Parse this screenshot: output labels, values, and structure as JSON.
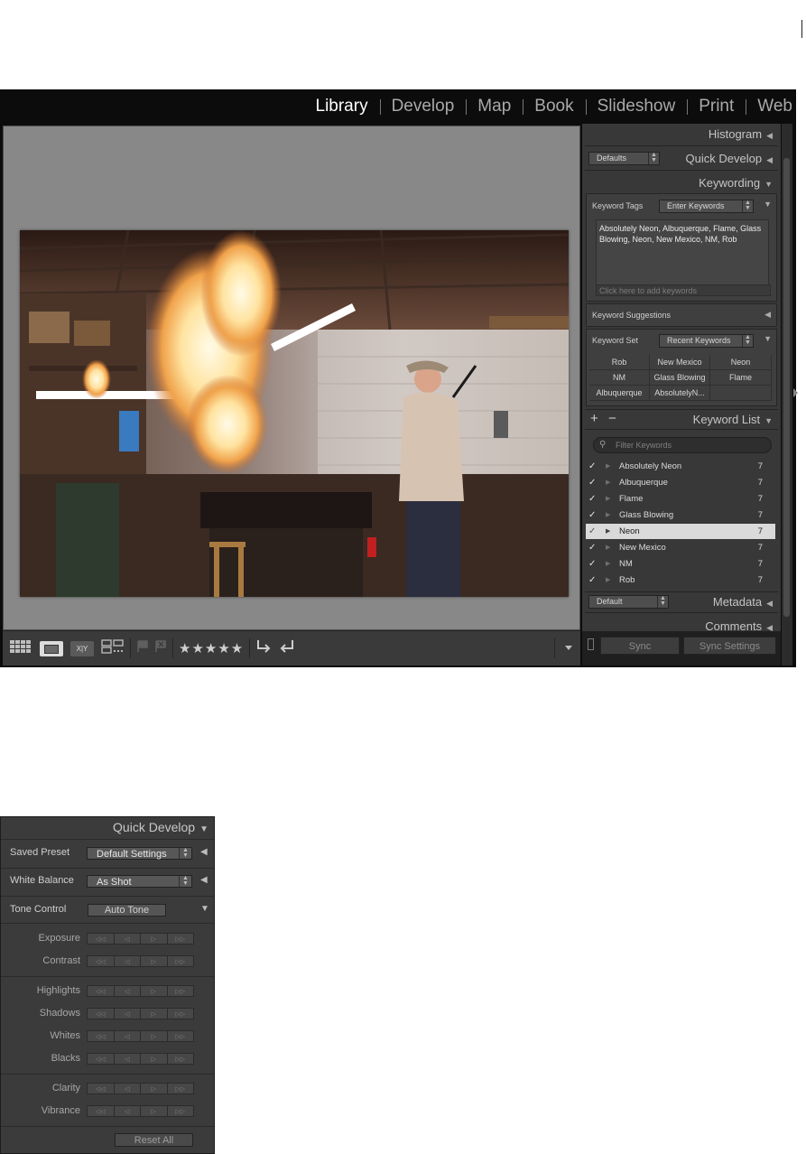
{
  "modules": [
    "Library",
    "Develop",
    "Map",
    "Book",
    "Slideshow",
    "Print",
    "Web"
  ],
  "active_module": "Library",
  "toolbar": {
    "view_icons": [
      "grid-view-icon",
      "loupe-view-icon",
      "compare-view-icon",
      "survey-view-icon"
    ],
    "compare_label": "X|Y",
    "stars": "★★★★★"
  },
  "right_panel": {
    "histogram": "Histogram",
    "quick_develop": {
      "title": "Quick Develop",
      "preset": "Defaults"
    },
    "keywording": {
      "title": "Keywording",
      "tags_label": "Keyword Tags",
      "tags_mode": "Enter Keywords",
      "tags_text": "Absolutely Neon, Albuquerque, Flame, Glass Blowing, Neon, New Mexico, NM, Rob",
      "add_placeholder": "Click here to add keywords",
      "suggestions_label": "Keyword Suggestions",
      "set_label": "Keyword Set",
      "set_value": "Recent Keywords",
      "set_grid": [
        "Rob",
        "New Mexico",
        "Neon",
        "NM",
        "Glass Blowing",
        "Flame",
        "Albuquerque",
        "AbsolutelyN...",
        ""
      ]
    },
    "keyword_list": {
      "title": "Keyword List",
      "plus": "+",
      "minus": "−",
      "filter_placeholder": "Filter Keywords",
      "items": [
        {
          "name": "Absolutely Neon",
          "count": "7",
          "check": "✓"
        },
        {
          "name": "Albuquerque",
          "count": "7",
          "check": "✓"
        },
        {
          "name": "Flame",
          "count": "7",
          "check": "✓"
        },
        {
          "name": "Glass Blowing",
          "count": "7",
          "check": "✓"
        },
        {
          "name": "Neon",
          "count": "7",
          "check": "✓"
        },
        {
          "name": "New Mexico",
          "count": "7",
          "check": "✓"
        },
        {
          "name": "NM",
          "count": "7",
          "check": "✓"
        },
        {
          "name": "Rob",
          "count": "7",
          "check": "✓"
        }
      ]
    },
    "metadata": {
      "title": "Metadata",
      "preset": "Default"
    },
    "comments": "Comments",
    "sync": "Sync",
    "sync_settings": "Sync Settings"
  },
  "quick_develop_panel": {
    "title": "Quick Develop",
    "saved_preset_label": "Saved Preset",
    "saved_preset_value": "Default Settings",
    "white_balance_label": "White Balance",
    "white_balance_value": "As Shot",
    "tone_control_label": "Tone Control",
    "auto_tone": "Auto Tone",
    "adjustments": [
      "Exposure",
      "Contrast",
      "Highlights",
      "Shadows",
      "Whites",
      "Blacks",
      "Clarity",
      "Vibrance"
    ],
    "step_buttons": [
      "◁◁",
      "◁",
      "▷",
      "▷▷"
    ],
    "reset_all": "Reset All"
  }
}
